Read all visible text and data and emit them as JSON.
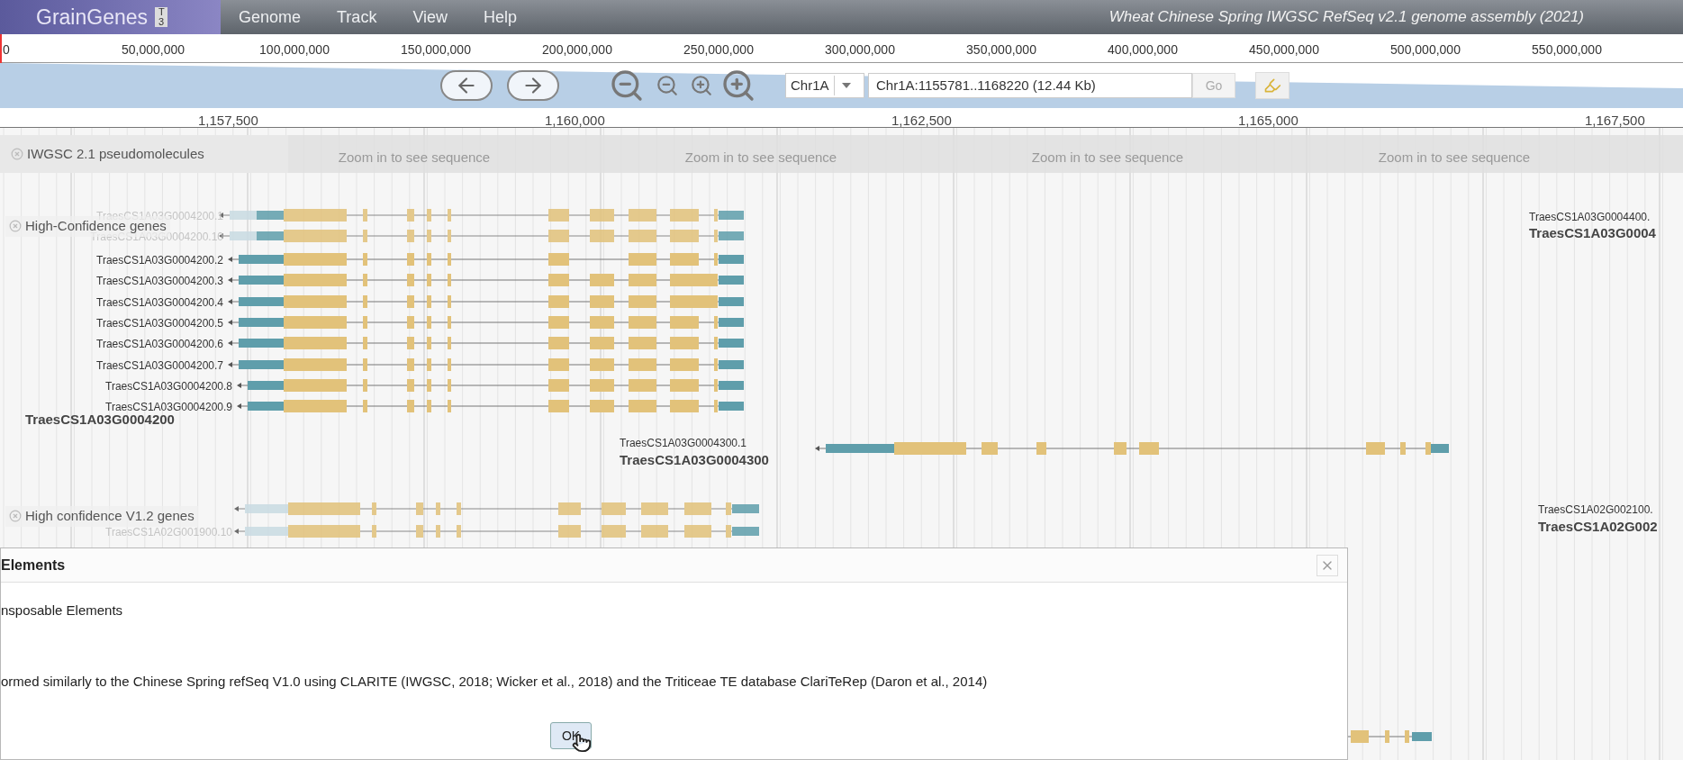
{
  "menu_bar": {
    "logo": "GrainGenes",
    "logo_badge": "T3",
    "menus": [
      "Genome",
      "Track",
      "View",
      "Help"
    ],
    "title": "Wheat Chinese Spring IWGSC RefSeq v2.1 genome assembly (2021)"
  },
  "overview_ruler": [
    "0",
    "50,000,000",
    "100,000,000",
    "150,000,000",
    "200,000,000",
    "250,000,000",
    "300,000,000",
    "350,000,000",
    "400,000,000",
    "450,000,000",
    "500,000,000",
    "550,000,000"
  ],
  "navigation": {
    "chromosome": "Chr1A",
    "location": "Chr1A:1155781..1168220 (12.44 Kb)",
    "go": "Go"
  },
  "detail_ruler": [
    "1,157,500",
    "1,160,000",
    "1,162,500",
    "1,165,000",
    "1,167,500"
  ],
  "tracks": [
    {
      "kind": "sequence",
      "label": "IWGSC 2.1 pseudomolecules",
      "messages": [
        "Zoom in to see sequence",
        "Zoom in to see sequence",
        "Zoom in to see sequence",
        "Zoom in to see sequence"
      ]
    },
    {
      "kind": "genes",
      "label": "High-Confidence genes",
      "genes": [
        {
          "name": "TraesCS1A03G0004200",
          "transcripts": [
            "TraesCS1A03G0004200.1",
            "TraesCS1A03G0004200.10",
            "TraesCS1A03G0004200.2",
            "TraesCS1A03G0004200.3",
            "TraesCS1A03G0004200.4",
            "TraesCS1A03G0004200.5",
            "TraesCS1A03G0004200.6",
            "TraesCS1A03G0004200.7",
            "TraesCS1A03G0004200.8",
            "TraesCS1A03G0004200.9"
          ]
        },
        {
          "name": "TraesCS1A03G0004300",
          "transcripts": [
            "TraesCS1A03G0004300.1"
          ]
        },
        {
          "name": "TraesCS1A03G0004",
          "transcripts": [
            "TraesCS1A03G0004400."
          ]
        }
      ]
    },
    {
      "kind": "genes",
      "label": "High confidence V1.2 genes",
      "genes": [
        {
          "transcripts": [
            "TraesCS1A02G001900.10"
          ]
        },
        {
          "name": "TraesCS1A02G002",
          "transcripts": [
            "TraesCS1A02G002100."
          ]
        }
      ]
    }
  ],
  "dialog": {
    "title": "Elements",
    "lines": [
      "nsposable Elements",
      "ormed similarly to the Chinese Spring refSeq V1.0 using CLARITE (IWGSC, 2018; Wicker et al., 2018) and the Triticeae TE database ClariTeRep (Daron et al., 2014)"
    ],
    "button": "OK"
  }
}
